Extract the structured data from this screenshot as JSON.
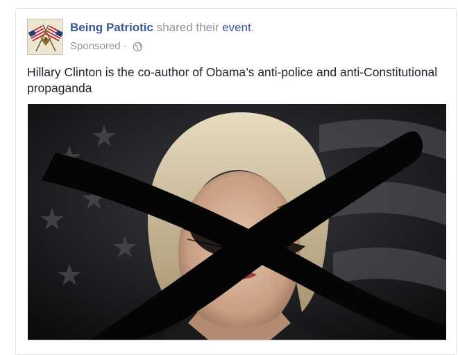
{
  "post": {
    "page_name": "Being Patriotic",
    "action_text": " shared their ",
    "event_text": "event",
    "period": ".",
    "sponsored_label": "Sponsored",
    "separator": " · ",
    "privacy_icon": "globe-icon",
    "body_text": "Hillary Clinton is the co-author of Obama’s anti-police and anti-Constitutional propaganda",
    "avatar_icon": "crossed-flags-eagle-icon",
    "image_description_icon": "defaced-portrait-photo"
  },
  "colors": {
    "link_blue": "#365899",
    "meta_gray": "#90949c",
    "text_dark": "#1d2129",
    "border": "#dddfe2"
  }
}
